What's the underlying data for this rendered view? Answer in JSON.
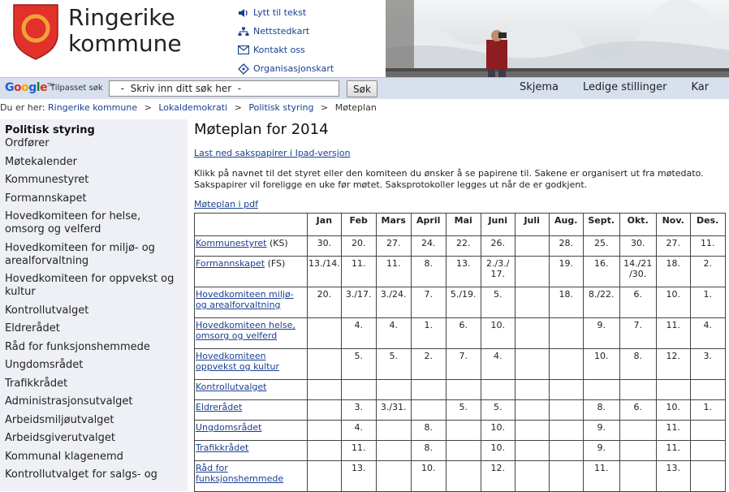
{
  "header": {
    "logo_line1": "Ringerike",
    "logo_line2": "kommune",
    "links": [
      {
        "label": "Lytt til tekst",
        "icon": "speaker-icon"
      },
      {
        "label": "Nettstedkart",
        "icon": "sitemap-icon"
      },
      {
        "label": "Kontakt oss",
        "icon": "envelope-icon"
      },
      {
        "label": "Organisasjonskart",
        "icon": "org-chart-icon"
      }
    ]
  },
  "search": {
    "brand": "Google",
    "caption": "Tilpasset søk",
    "value": "  -  Skriv inn ditt søk her  -",
    "button": "Søk"
  },
  "topnav": [
    "Skjema",
    "Ledige stillinger",
    "Kar"
  ],
  "breadcrumb": {
    "prefix": "Du er her:",
    "items": [
      "Ringerike kommune",
      "Lokaldemokrati",
      "Politisk styring"
    ],
    "current": "Møteplan",
    "separator": ">"
  },
  "sidebar": {
    "heading": "Politisk styring",
    "items": [
      "Ordfører",
      "Møtekalender",
      "Kommunestyret",
      "Formannskapet",
      "Hovedkomiteen for helse, omsorg og velferd",
      "Hovedkomiteen for miljø- og arealforvaltning",
      "Hovedkomiteen for oppvekst og kultur",
      "Kontrollutvalget",
      "Eldrerådet",
      "Råd for funksjonshemmede",
      "Ungdomsrådet",
      "Trafikkrådet",
      "Administrasjonsutvalget",
      "Arbeidsmiljøutvalget",
      "Arbeidsgiverutvalget",
      "Kommunal klagenemd",
      "Kontrollutvalget for salgs- og"
    ]
  },
  "main": {
    "title": "Møteplan for 2014",
    "ipad_link": "Last ned sakspapirer i Ipad-versjon",
    "intro": "Klikk på navnet til det styret eller den komiteen du ønsker å se papirene til. Sakene er organisert ut fra møtedato. Sakspapirer vil foreligge en uke før møtet. Saksprotokoller legges ut når de er godkjent.",
    "pdf_link": "Møteplan i pdf"
  },
  "table": {
    "months": [
      "Jan",
      "Feb",
      "Mars",
      "April",
      "Mai",
      "Juni",
      "Juli",
      "Aug.",
      "Sept.",
      "Okt.",
      "Nov.",
      "Des."
    ],
    "rows": [
      {
        "name": "Kommunestyret",
        "suffix": " (KS)",
        "cells": [
          "30.",
          "20.",
          "27.",
          "24.",
          "22.",
          "26.",
          "",
          "28.",
          "25.",
          "30.",
          "27.",
          "11."
        ]
      },
      {
        "name": "Formannskapet",
        "suffix": " (FS)",
        "cells": [
          "13./14.",
          "11.",
          "11.",
          "8.",
          "13.",
          "2./3./ 17.",
          "",
          "19.",
          "16.",
          "14./21 /30.",
          "18.",
          "2."
        ]
      },
      {
        "name": "Hovedkomiteen miljø- og arealforvaltning",
        "suffix": "",
        "cells": [
          "20.",
          "3./17.",
          "3./24.",
          "7.",
          "5./19.",
          "5.",
          "",
          "18.",
          "8./22.",
          "6.",
          "10.",
          "1."
        ]
      },
      {
        "name": "Hovedkomiteen helse, omsorg og velferd",
        "suffix": "",
        "cells": [
          "",
          "4.",
          "4.",
          "1.",
          "6.",
          "10.",
          "",
          "",
          "9.",
          "7.",
          "11.",
          "4."
        ]
      },
      {
        "name": "Hovedkomiteen oppvekst og kultur",
        "suffix": "",
        "cells": [
          "",
          "5.",
          "5.",
          "2.",
          "7.",
          "4.",
          "",
          "",
          "10.",
          "8.",
          "12.",
          "3."
        ]
      },
      {
        "name": "Kontrollutvalget",
        "suffix": "",
        "cells": [
          "",
          "",
          "",
          "",
          "",
          "",
          "",
          "",
          "",
          "",
          "",
          ""
        ]
      },
      {
        "name": "Eldrerådet",
        "suffix": "",
        "cells": [
          "",
          "3.",
          "3./31.",
          "",
          "5.",
          "5.",
          "",
          "",
          "8.",
          "6.",
          "10.",
          "1."
        ]
      },
      {
        "name": "Ungdomsrådet",
        "suffix": "",
        "cells": [
          "",
          "4.",
          "",
          "8.",
          "",
          "10.",
          "",
          "",
          "9.",
          "",
          "11.",
          ""
        ]
      },
      {
        "name": "Trafikkrådet",
        "suffix": "",
        "cells": [
          "",
          "11.",
          "",
          "8.",
          "",
          "10.",
          "",
          "",
          "9.",
          "",
          "11.",
          ""
        ]
      },
      {
        "name": "Råd for funksjonshemmede",
        "suffix": "",
        "cells": [
          "",
          "13.",
          "",
          "10.",
          "",
          "12.",
          "",
          "",
          "11.",
          "",
          "13.",
          ""
        ]
      }
    ]
  },
  "colors": {
    "shield_red": "#e2312b",
    "shield_ring": "#f2a23a",
    "link": "#1a3f8f",
    "sidebar_bg": "#eef0f6",
    "searchbar_bg": "#d7e0ec"
  }
}
